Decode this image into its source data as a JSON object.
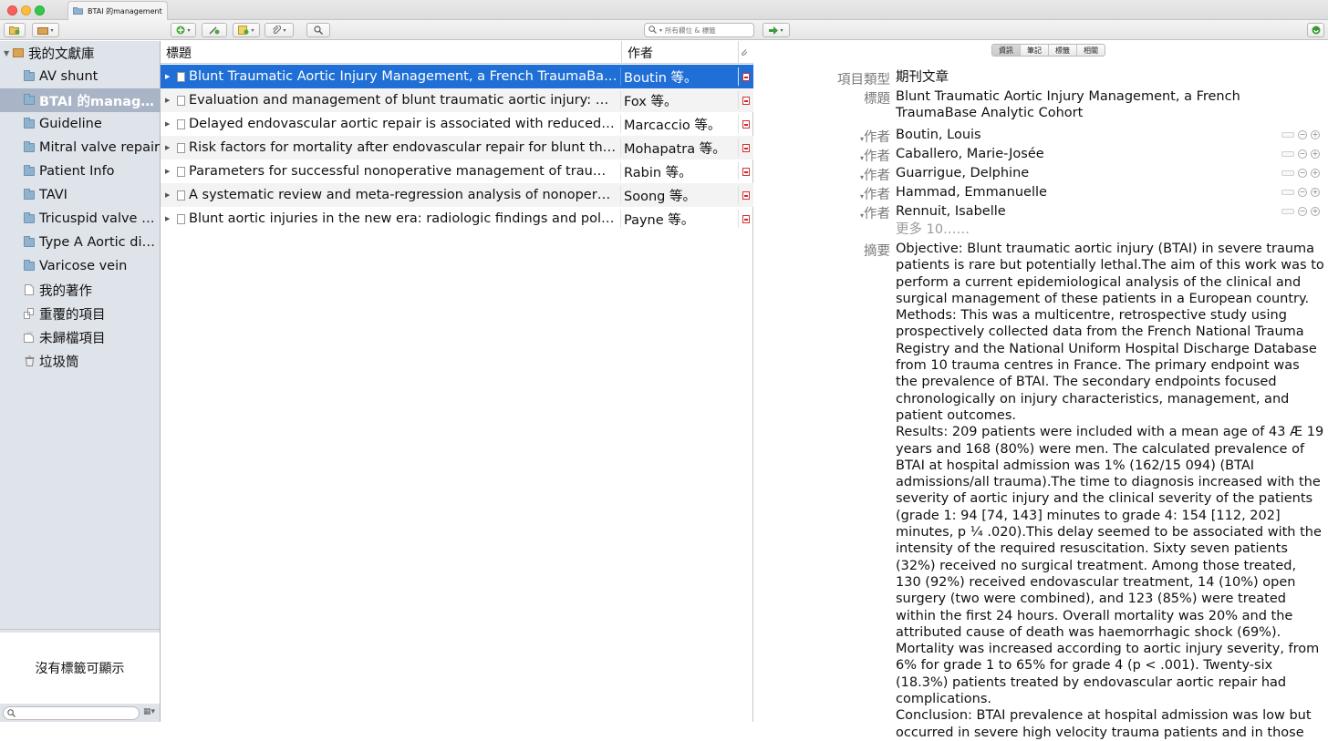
{
  "window": {
    "tab_title": "BTAI 的management"
  },
  "toolbar": {
    "search_placeholder": "所有欄位 & 標籤"
  },
  "sidebar": {
    "library_label": "我的文獻庫",
    "collections": [
      {
        "label": "AV shunt",
        "icon": "folder-icon"
      },
      {
        "label": "BTAI 的management",
        "icon": "folder-icon",
        "selected": true
      },
      {
        "label": "Guideline",
        "icon": "folder-icon"
      },
      {
        "label": "Mitral valve repair",
        "icon": "folder-icon"
      },
      {
        "label": "Patient Info",
        "icon": "folder-icon"
      },
      {
        "label": "TAVI",
        "icon": "folder-icon"
      },
      {
        "label": "Tricuspid valve repair",
        "icon": "folder-icon"
      },
      {
        "label": "Type A Aortic dissection",
        "icon": "folder-icon"
      },
      {
        "label": "Varicose vein",
        "icon": "folder-icon"
      }
    ],
    "special": [
      {
        "label": "我的著作",
        "icon": "document-icon"
      },
      {
        "label": "重覆的項目",
        "icon": "duplicate-icon"
      },
      {
        "label": "未歸檔項目",
        "icon": "unfiled-icon"
      },
      {
        "label": "垃圾筒",
        "icon": "trash-icon"
      }
    ],
    "tag_pane_empty": "沒有標籤可顯示"
  },
  "items": {
    "columns": {
      "title": "標題",
      "creator": "作者"
    },
    "rows": [
      {
        "title": "Blunt Traumatic Aortic Injury Management, a French TraumaBase Analytic Cohort",
        "creator": "Boutin 等。",
        "selected": true
      },
      {
        "title": "Evaluation and management of blunt traumatic aortic injury: A practice management guideline",
        "creator": "Fox 等。"
      },
      {
        "title": "Delayed endovascular aortic repair is associated with reduced in-hospital mortality",
        "creator": "Marcaccio 等。"
      },
      {
        "title": "Risk factors for mortality after endovascular repair for blunt thoracic aortic injury",
        "creator": "Mohapatra 等。"
      },
      {
        "title": "Parameters for successful nonoperative management of traumatic aortic injury",
        "creator": "Rabin 等。"
      },
      {
        "title": "A systematic review and meta-regression analysis of nonoperative management",
        "creator": "Soong 等。"
      },
      {
        "title": "Blunt aortic injuries in the new era: radiologic findings and polytrauma",
        "creator": "Payne 等。"
      }
    ]
  },
  "item_pane": {
    "tabs": [
      "資訊",
      "筆記",
      "標籤",
      "相關"
    ],
    "item_type_label": "項目類型",
    "item_type_value": "期刊文章",
    "title_label": "標題",
    "title_value": "Blunt Traumatic Aortic Injury Management, a French TraumaBase Analytic Cohort",
    "creator_label": "作者",
    "creators": [
      "Boutin, Louis",
      "Caballero, Marie-Josée",
      "Guarrigue, Delphine",
      "Hammad, Emmanuelle",
      "Rennuit, Isabelle"
    ],
    "more_creators": "更多 10……",
    "abstract_label": "摘要",
    "abstract": "Objective: Blunt traumatic aortic injury (BTAI) in severe trauma patients is rare but potentially lethal.The aim of this work was to perform a current epidemiological analysis of the clinical and surgical management of these patients in a European country.\nMethods: This was a multicentre, retrospective study using prospectively collected data from the French National Trauma Registry and the National Uniform Hospital Discharge Database from 10 trauma centres in France. The primary endpoint was the prevalence of BTAI. The secondary endpoints focused chronologically on injury characteristics, management, and patient outcomes.\nResults: 209 patients were included with a mean age of 43 Æ 19 years and 168 (80%) were men. The calculated prevalence of BTAI at hospital admission was 1% (162/15 094) (BTAI admissions/all trauma).The time to diagnosis increased with the severity of aortic injury and the clinical severity of the patients (grade 1: 94 [74, 143] minutes to grade 4: 154 [112, 202] minutes, p ¼ .020).This delay seemed to be associated with the intensity of the required resuscitation. Sixty seven patients (32%) received no surgical treatment. Among those treated, 130 (92%) received endovascular treatment, 14 (10%) open surgery (two were combined), and 123 (85%) were treated within the first 24 hours. Overall mortality was 20% and the attributed cause of death was haemorrhagic shock (69%). Mortality was increased according to aortic injury severity, from 6% for grade 1 to 65% for grade 4 (p < .001). Twenty-six (18.3%) patients treated by endovascular aortic repair had complications.\nConclusion: BTAI prevalence at hospital admission was low but occurred in severe high velocity trauma patients and in those"
  },
  "colors": {
    "selection_blue": "#1f6fd6",
    "sidebar_bg": "#dfe3ea",
    "sidebar_selected": "#a9b4c6"
  }
}
